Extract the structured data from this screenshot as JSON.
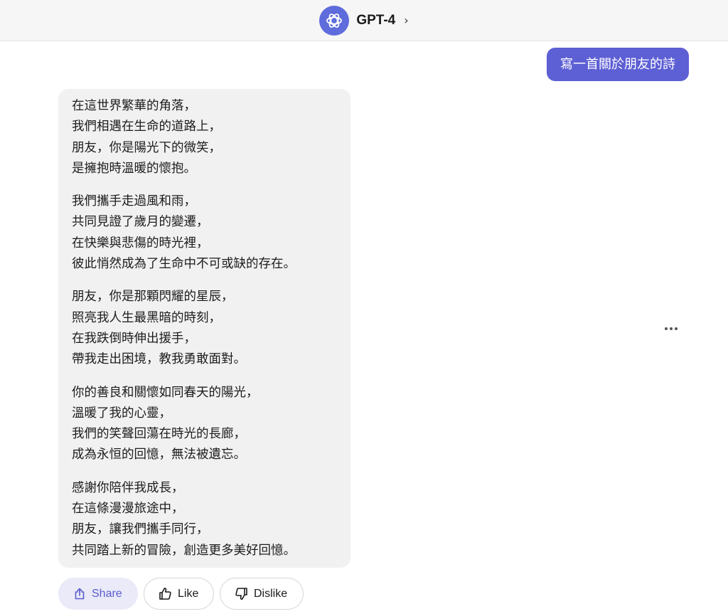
{
  "header": {
    "bot_name": "GPT-4",
    "chevron": "›",
    "avatar_icon": "openai-logo-icon"
  },
  "conversation": {
    "user_message": "寫一首關於朋友的詩",
    "bot_reply": {
      "stanzas": [
        [
          "在這世界繁華的角落，",
          "我們相遇在生命的道路上，",
          "朋友，你是陽光下的微笑，",
          "是擁抱時溫暖的懷抱。"
        ],
        [
          "我們攜手走過風和雨，",
          "共同見證了歲月的變遷，",
          "在快樂與悲傷的時光裡，",
          "彼此悄然成為了生命中不可或缺的存在。"
        ],
        [
          "朋友，你是那顆閃耀的星辰，",
          "照亮我人生最黑暗的時刻，",
          "在我跌倒時伸出援手，",
          "帶我走出困境，教我勇敢面對。"
        ],
        [
          "你的善良和關懷如同春天的陽光，",
          "溫暖了我的心靈，",
          "我們的笑聲回蕩在時光的長廊，",
          "成為永恒的回憶，無法被遺忘。"
        ],
        [
          "感謝你陪伴我成長，",
          "在這條漫漫旅途中，",
          "朋友，讓我們攜手同行，",
          "共同踏上新的冒險，創造更多美好回憶。"
        ]
      ]
    }
  },
  "actions": {
    "share_label": "Share",
    "like_label": "Like",
    "dislike_label": "Dislike"
  },
  "colors": {
    "accent": "#5d5fd4",
    "bot_bubble": "#f1f1f1",
    "header_bg": "#f6f6f6"
  }
}
